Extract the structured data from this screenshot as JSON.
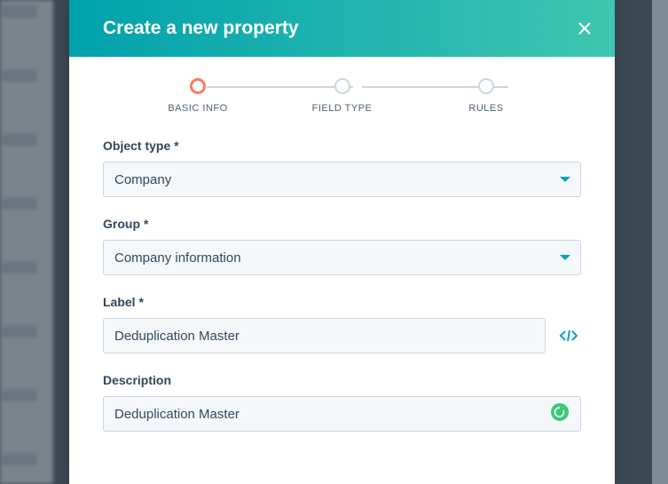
{
  "modal": {
    "title": "Create a new property"
  },
  "stepper": {
    "steps": [
      {
        "label": "BASIC INFO",
        "active": true
      },
      {
        "label": "FIELD TYPE",
        "active": false
      },
      {
        "label": "RULES",
        "active": false
      }
    ]
  },
  "form": {
    "object_type": {
      "label": "Object type *",
      "value": "Company"
    },
    "group": {
      "label": "Group *",
      "value": "Company information"
    },
    "label_field": {
      "label": "Label *",
      "value": "Deduplication Master"
    },
    "description": {
      "label": "Description",
      "value": "Deduplication Master"
    }
  }
}
